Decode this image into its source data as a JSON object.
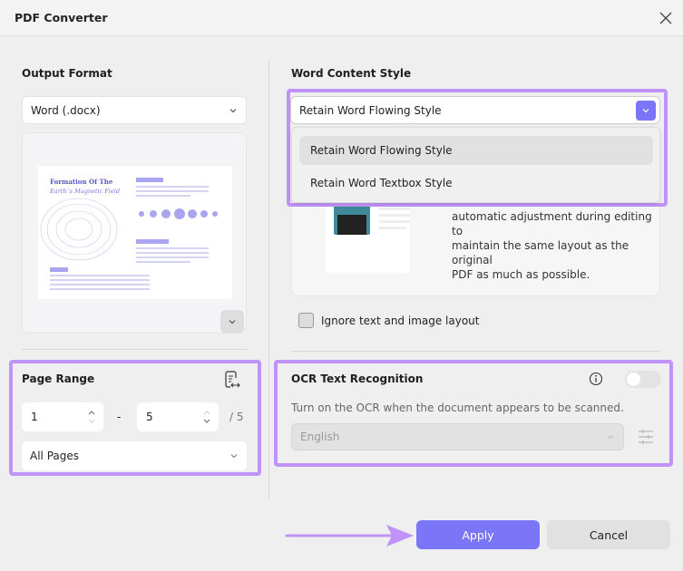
{
  "window": {
    "title": "PDF Converter"
  },
  "output_format": {
    "heading": "Output Format",
    "selected": "Word (.docx)"
  },
  "preview": {
    "thumb_title_1": "Formation Of The",
    "thumb_title_2": "Earth`s Magnetic Field"
  },
  "page_range": {
    "heading": "Page Range",
    "from": "1",
    "separator": "-",
    "to": "5",
    "total": "/ 5",
    "mode": "All Pages"
  },
  "word_style": {
    "heading": "Word Content Style",
    "selected": "Retain Word Flowing Style",
    "options": [
      "Retain Word Flowing Style",
      "Retain Word Textbox Style"
    ],
    "description_lines": [
      "automatic adjustment during editing to",
      "maintain the same layout as the original",
      "PDF as much as possible."
    ],
    "ignore_label": "Ignore text and image layout"
  },
  "ocr": {
    "heading": "OCR Text Recognition",
    "description": "Turn on the OCR when the document appears to be scanned.",
    "language": "English",
    "enabled": false
  },
  "footer": {
    "apply": "Apply",
    "cancel": "Cancel"
  },
  "colors": {
    "accent": "#7b76f7",
    "highlight": "#bf93f7"
  }
}
